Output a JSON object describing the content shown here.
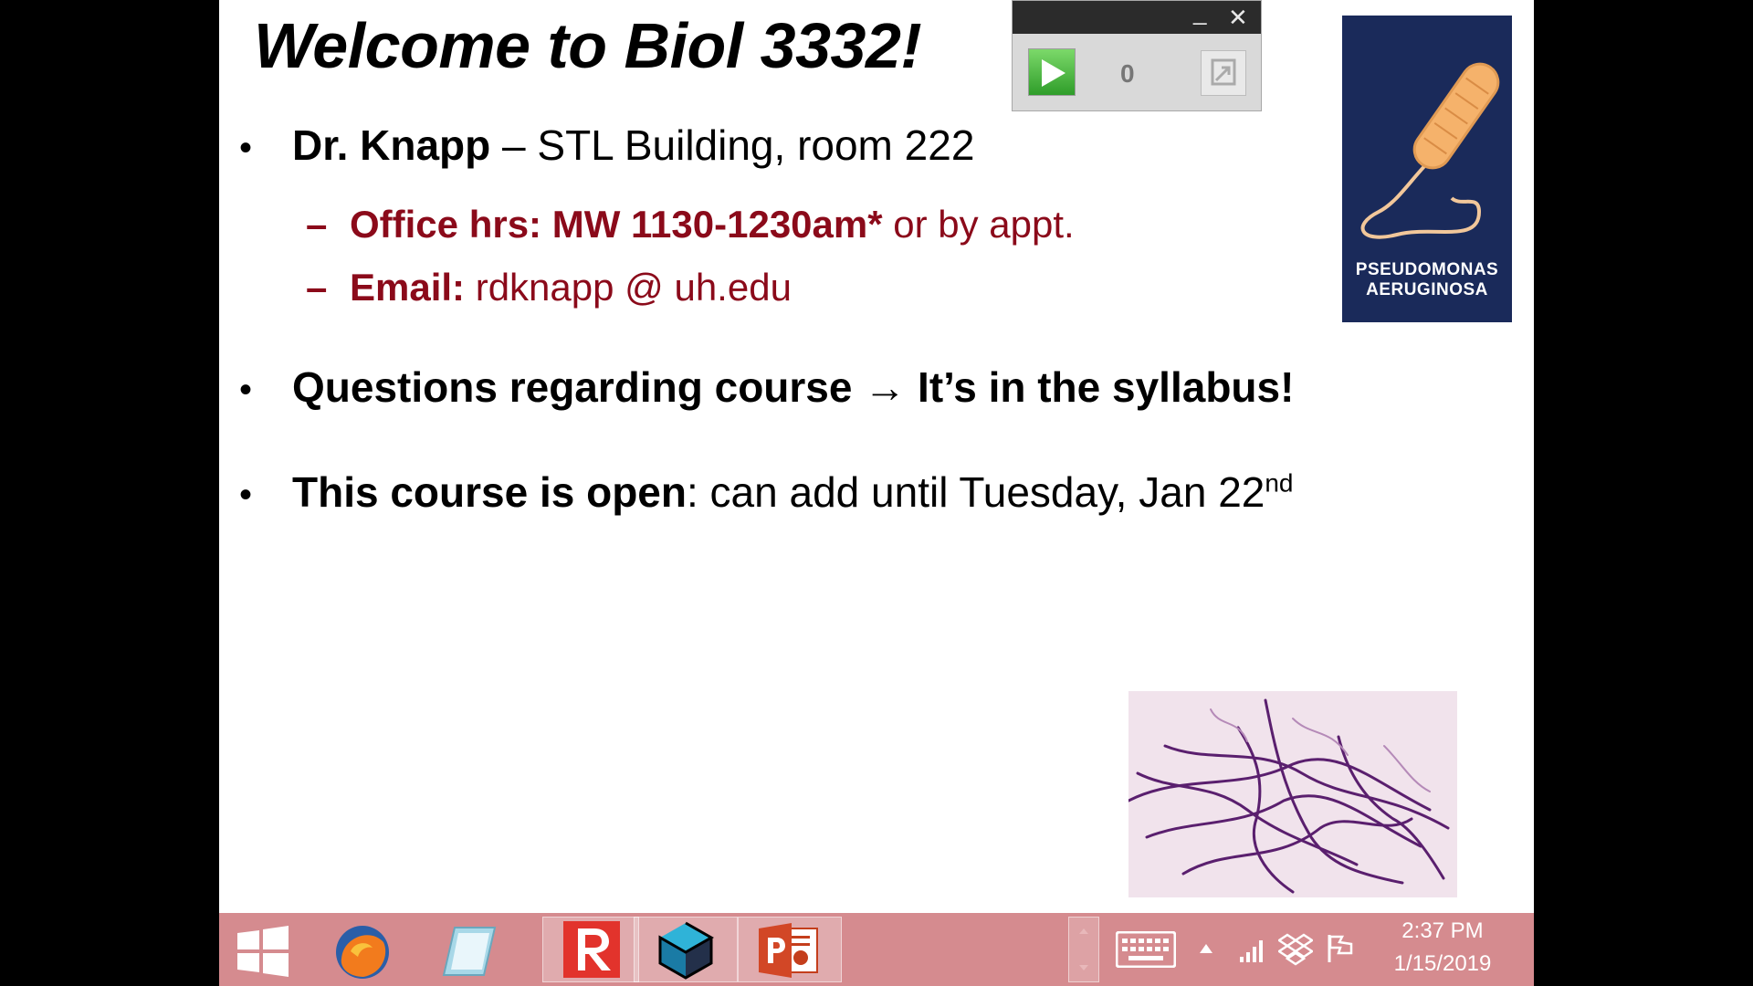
{
  "slide": {
    "title": "Welcome to Biol 3332!",
    "bullet1": {
      "bold": "Dr. Knapp",
      "rest": " – STL Building, room 222"
    },
    "office": {
      "bold": "Office hrs:  MW 1130-1230am*",
      "rest": " or by appt."
    },
    "email": {
      "bold": "Email:",
      "rest": " rdknapp @ uh.edu"
    },
    "bullet2": {
      "bold_start": "Questions regarding course ",
      "arrow": "→",
      "bold_end": " It’s in the syllabus!"
    },
    "bullet3": {
      "bold": "This course is open",
      "rest": ": can add until Tuesday, Jan 22",
      "sup": "nd"
    },
    "bullet_glyph": "•",
    "dash_glyph": "–"
  },
  "player": {
    "minimize_label": "_",
    "close_label": "✕",
    "counter": "0",
    "play_icon": "play-icon",
    "expand_icon": "expand-icon"
  },
  "logo": {
    "line1": "PSEUDOMONAS",
    "line2": "AERUGINOSA"
  },
  "taskbar": {
    "apps": [
      "windows-start-icon",
      "firefox-icon",
      "notepad-icon",
      "r-app-icon",
      "cube-app-icon",
      "powerpoint-icon"
    ],
    "tray_icons": [
      "keyboard-icon",
      "chevron-up-icon",
      "signal-icon",
      "dropbox-icon",
      "flag-icon"
    ],
    "time": "2:37 PM",
    "date": "1/15/2019"
  },
  "colors": {
    "taskbar": "#d58b8f",
    "logo_bg": "#1a2a5a",
    "sub_text": "#8b0a1a",
    "title_bar": "#2b2b2b"
  }
}
